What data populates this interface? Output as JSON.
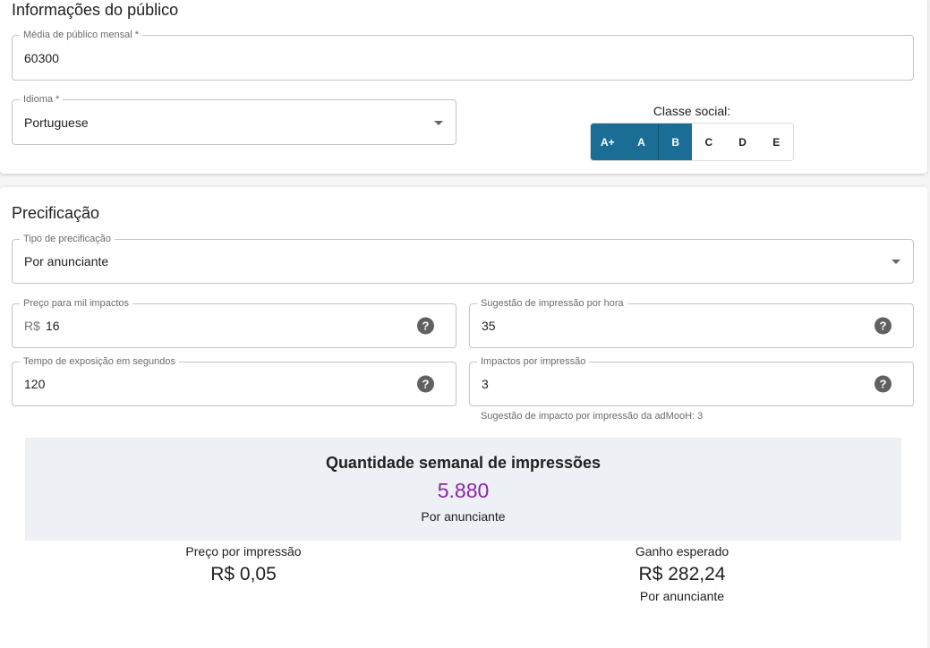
{
  "publico": {
    "title": "Informações do público",
    "media": {
      "label": "Média de público mensal *",
      "value": "60300"
    },
    "idioma": {
      "label": "Idioma *",
      "value": "Portuguese"
    },
    "classe": {
      "label": "Classe social:",
      "options": [
        {
          "label": "A+",
          "selected": true
        },
        {
          "label": "A",
          "selected": true
        },
        {
          "label": "B",
          "selected": true
        },
        {
          "label": "C",
          "selected": false
        },
        {
          "label": "D",
          "selected": false
        },
        {
          "label": "E",
          "selected": false
        }
      ]
    }
  },
  "precificacao": {
    "title": "Precificação",
    "tipo": {
      "label": "Tipo de precificação",
      "value": "Por anunciante"
    },
    "preco_mil": {
      "label": "Preço para mil impactos",
      "prefix": "R$",
      "value": "16"
    },
    "sugestao_hora": {
      "label": "Sugestão de impressão por hora",
      "value": "35"
    },
    "tempo": {
      "label": "Tempo de exposição em segundos",
      "value": "120"
    },
    "impactos": {
      "label": "Impactos por impressão",
      "value": "3",
      "hint": "Sugestão de impacto por impressão da adMooH: 3"
    },
    "help_glyph": "?"
  },
  "summary": {
    "title": "Quantidade semanal de impressões",
    "value": "5.880",
    "sub": "Por anunciante"
  },
  "preco_impressao": {
    "label": "Preço por impressão",
    "value": "R$ 0,05"
  },
  "ganho": {
    "label": "Ganho esperado",
    "value": "R$ 282,24",
    "sub": "Por anunciante"
  },
  "colors": {
    "accent": "#1a6e96",
    "highlight": "#8e24aa",
    "summary_bg": "#edf0f4"
  }
}
